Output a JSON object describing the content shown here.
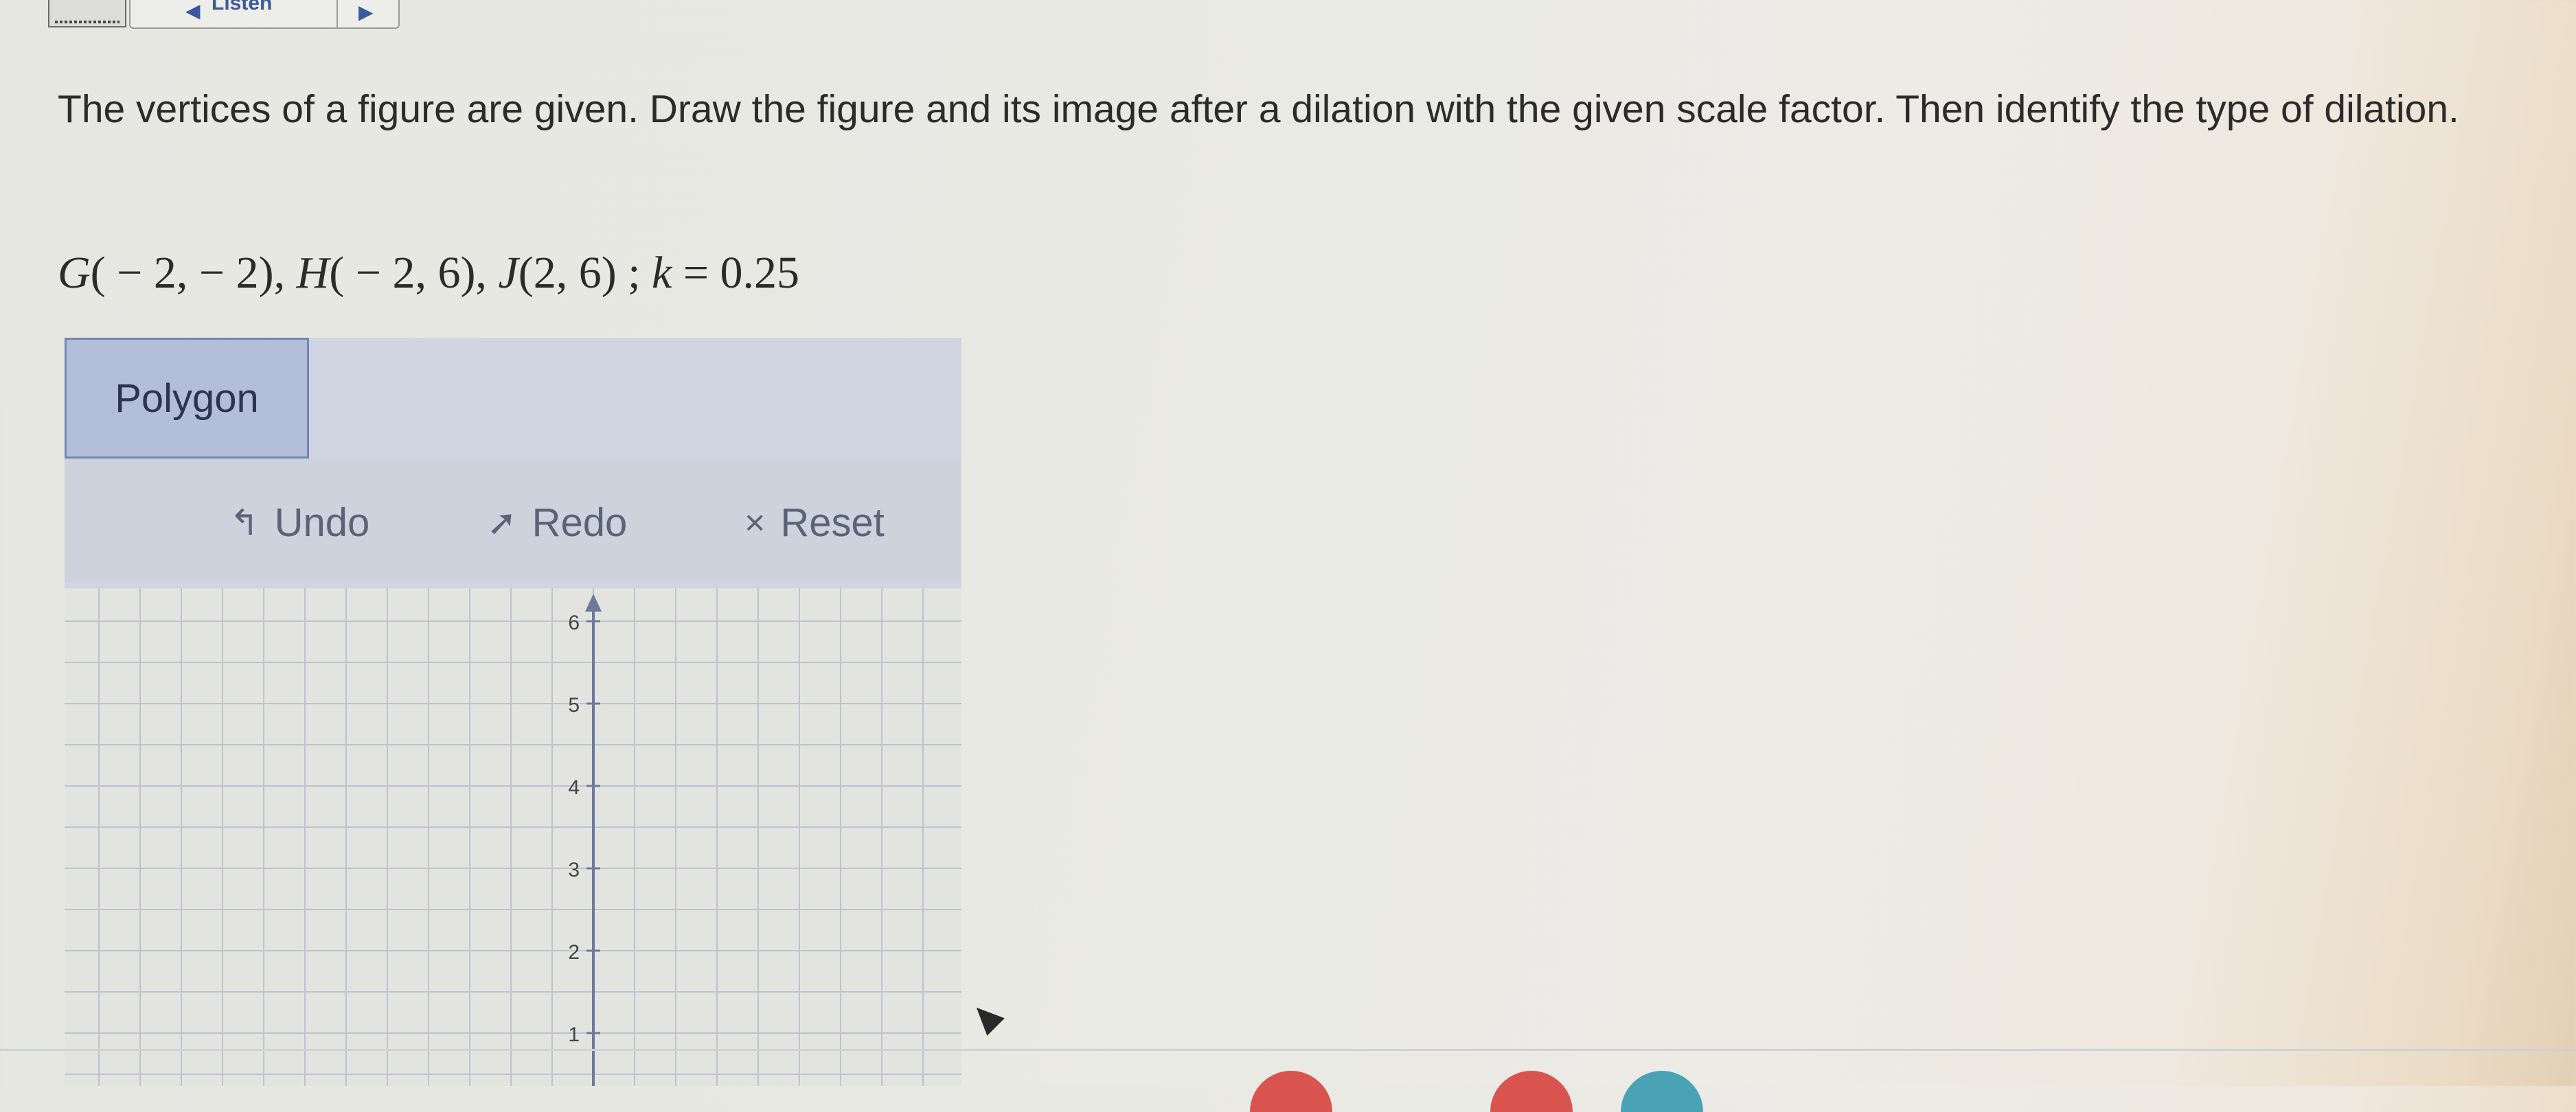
{
  "toolbar": {
    "listen_label": "Listen"
  },
  "question": {
    "prompt": "The vertices of a figure are given. Draw the figure and its image after a dilation with the given scale factor. Then identify the type of dilation.",
    "equation_parts": {
      "g": "G",
      "g_coords": "( − 2, − 2), ",
      "h": "H",
      "h_coords": "( − 2, 6), ",
      "j": "J",
      "j_coords": "(2, 6) ;  ",
      "k": "k",
      "k_value": " = 0.25"
    }
  },
  "tools": {
    "polygon_label": "Polygon",
    "undo_label": "Undo",
    "redo_label": "Redo",
    "reset_label": "Reset"
  },
  "graph": {
    "y_ticks": [
      "6",
      "5",
      "4",
      "3",
      "2",
      "1"
    ],
    "grid_color": "#bcc4d2",
    "axis_color": "#6e7a9a"
  },
  "colors": {
    "accent": "#7287b4",
    "panel": "#d0d5e1"
  }
}
